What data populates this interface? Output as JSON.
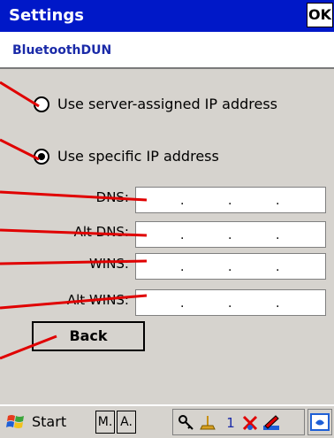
{
  "window": {
    "title": "Settings",
    "ok_label": "OK",
    "subtitle": "BluetoothDUN"
  },
  "options": {
    "server_assigned_label": "Use server-assigned IP address",
    "server_assigned_selected": false,
    "specific_label": "Use specific IP address",
    "specific_selected": true
  },
  "fields": {
    "dns_label": "DNS:",
    "alt_dns_label": "Alt DNS:",
    "wins_label": "WINS:",
    "alt_wins_label": "Alt WINS:",
    "separator": "."
  },
  "back_label": "Back",
  "taskbar": {
    "start_label": "Start",
    "m_label": "M.",
    "a_label": "A.",
    "tray_number": "1",
    "icons": [
      "windows-flag-icon",
      "key-icon",
      "lamp-icon",
      "connection-x-icon",
      "pencil-icon",
      "keyboard-icon"
    ]
  },
  "colors": {
    "title_bar": "#0018c8",
    "subtitle_text": "#1a2aa8",
    "panel": "#d6d3ce",
    "annotation_lines": "#e00000"
  }
}
